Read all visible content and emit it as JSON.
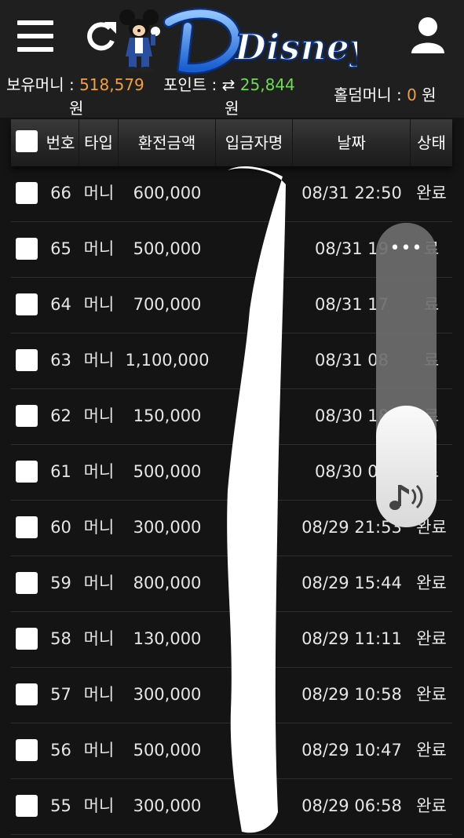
{
  "header": {
    "logo_text": "Disney",
    "icons": {
      "menu": "hamburger-menu-icon",
      "refresh": "refresh-icon",
      "user": "user-icon"
    }
  },
  "balance": {
    "money_label": "보유머니 :",
    "money_value": "518,579",
    "money_unit": "원",
    "points_label": "포인트 :",
    "points_icon": "exchange-arrows-icon",
    "points_value": "25,844",
    "points_unit": "원",
    "holdem_label": "홀덤머니 :",
    "holdem_value": "0",
    "holdem_unit": "원",
    "colors": {
      "money": "#f0a040",
      "points": "#6ddc4e",
      "holdem": "#f0a040"
    }
  },
  "table": {
    "headers": [
      "번호",
      "타입",
      "환전금액",
      "입금자명",
      "날짜",
      "상태"
    ],
    "rows": [
      {
        "no": "66",
        "type": "머니",
        "amount": "600,000",
        "name": "",
        "date": "08/31 22:50",
        "status": "완료"
      },
      {
        "no": "65",
        "type": "머니",
        "amount": "500,000",
        "name": "",
        "date": "08/31 19",
        "status": "료"
      },
      {
        "no": "64",
        "type": "머니",
        "amount": "700,000",
        "name": "",
        "date": "08/31 17",
        "status": "료"
      },
      {
        "no": "63",
        "type": "머니",
        "amount": "1,100,000",
        "name": "",
        "date": "08/31 08",
        "status": "료"
      },
      {
        "no": "62",
        "type": "머니",
        "amount": "150,000",
        "name": "",
        "date": "08/30 18",
        "status": "료"
      },
      {
        "no": "61",
        "type": "머니",
        "amount": "500,000",
        "name": "",
        "date": "08/30 04",
        "status": "료"
      },
      {
        "no": "60",
        "type": "머니",
        "amount": "300,000",
        "name": "",
        "date": "08/29 21:53",
        "status": "완료"
      },
      {
        "no": "59",
        "type": "머니",
        "amount": "800,000",
        "name": "",
        "date": "08/29 15:44",
        "status": "완료"
      },
      {
        "no": "58",
        "type": "머니",
        "amount": "130,000",
        "name": "",
        "date": "08/29 11:11",
        "status": "완료"
      },
      {
        "no": "57",
        "type": "머니",
        "amount": "300,000",
        "name": "",
        "date": "08/29 10:58",
        "status": "완료"
      },
      {
        "no": "56",
        "type": "머니",
        "amount": "500,000",
        "name": "",
        "date": "08/29 10:47",
        "status": "완료"
      },
      {
        "no": "55",
        "type": "머니",
        "amount": "300,000",
        "name": "",
        "date": "08/29 06:58",
        "status": "완료"
      }
    ]
  },
  "volume_overlay": {
    "more_label": "•••",
    "level": 0.4,
    "icon": "music-note-volume-icon"
  }
}
